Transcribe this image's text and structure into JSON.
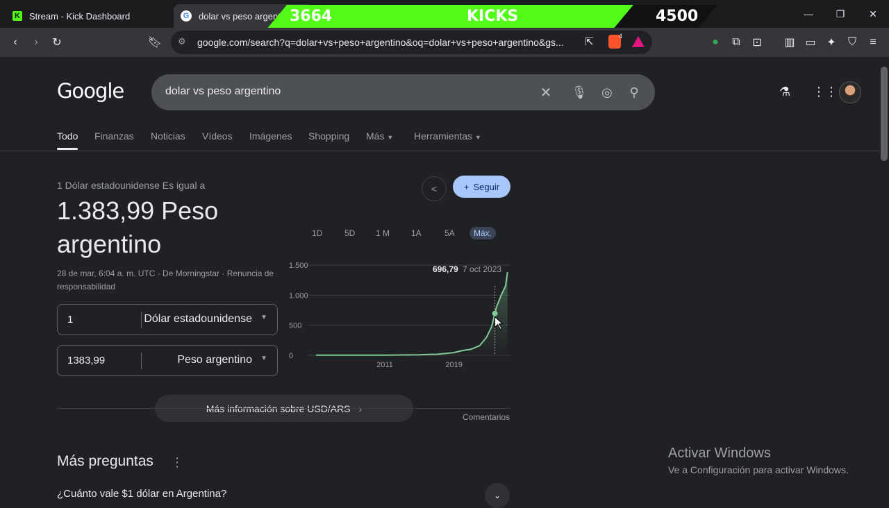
{
  "browser": {
    "tabs": [
      {
        "title": "Stream - Kick Dashboard",
        "favicon": "kick-icon"
      },
      {
        "title": "dolar vs peso argentino",
        "favicon": "google-icon"
      }
    ],
    "url": "google.com/search?q=dolar+vs+peso+argentino&oq=dolar+vs+peso+argentino&gs...",
    "extension_badge": "4"
  },
  "kicks_overlay": {
    "label": "KICKS",
    "current": "3664",
    "goal": "4500",
    "progress_fraction": 0.814,
    "color": "#53fc18"
  },
  "google": {
    "logo": "Google",
    "query": "dolar vs peso argentino",
    "nav": [
      "Todo",
      "Finanzas",
      "Noticias",
      "Vídeos",
      "Imágenes",
      "Shopping",
      "Más",
      "Herramientas"
    ]
  },
  "converter": {
    "equals_label": "1 Dólar estadounidense Es igual a",
    "result": "1.383,99 Peso argentino",
    "meta": "28 de mar, 6:04 a. m. UTC · De Morningstar · Renuncia de responsabilidad",
    "from_amount": "1",
    "from_currency": "Dólar estadounidense",
    "to_amount": "1383,99",
    "to_currency": "Peso argentino",
    "follow_label": "Seguir",
    "ranges": [
      "1D",
      "5D",
      "1 M",
      "1A",
      "5A",
      "Máx."
    ],
    "active_range": "Máx.",
    "more_info": "Más información sobre USD/ARS",
    "comments": "Comentarios"
  },
  "chart_data": {
    "type": "area",
    "yticks": [
      "1.500",
      "1.000",
      "500",
      "0"
    ],
    "xticks": [
      "2011",
      "2019"
    ],
    "ylim": [
      0,
      1500
    ],
    "tooltip_value": "696,79",
    "tooltip_date": "7 oct 2023",
    "line_color": "#81c995",
    "series": [
      {
        "values": [
          [
            2003,
            3
          ],
          [
            2005,
            3
          ],
          [
            2007,
            3
          ],
          [
            2009,
            4
          ],
          [
            2011,
            4
          ],
          [
            2013,
            6
          ],
          [
            2015,
            9
          ],
          [
            2016,
            15
          ],
          [
            2017,
            17
          ],
          [
            2018,
            30
          ],
          [
            2019,
            45
          ],
          [
            2020,
            80
          ],
          [
            2021,
            100
          ],
          [
            2022,
            160
          ],
          [
            2022.8,
            300
          ],
          [
            2023.4,
            480
          ],
          [
            2023.77,
            696.79
          ],
          [
            2024,
            820
          ],
          [
            2024.5,
            1000
          ],
          [
            2025,
            1150
          ],
          [
            2025.24,
            1383.99
          ]
        ]
      }
    ]
  },
  "more_questions": {
    "title": "Más preguntas",
    "first_question": "¿Cuánto vale $1 dólar en Argentina?"
  },
  "windows_watermark": {
    "title": "Activar Windows",
    "subtitle": "Ve a Configuración para activar Windows."
  }
}
